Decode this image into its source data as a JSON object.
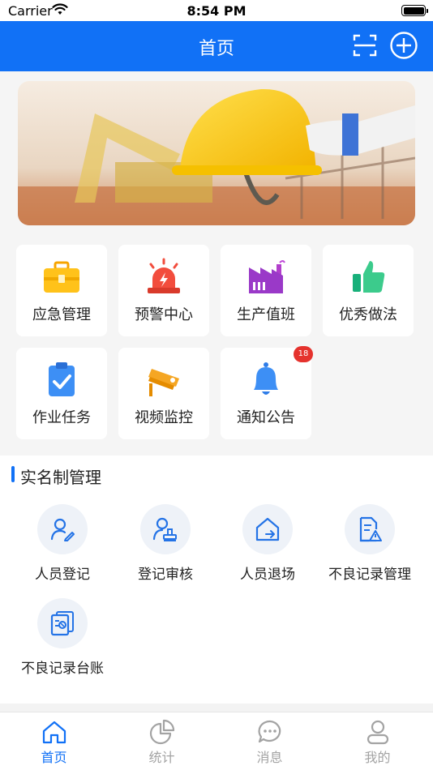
{
  "status_bar": {
    "carrier": "Carrier",
    "time": "8:54 PM"
  },
  "nav": {
    "title": "首页"
  },
  "tiles": [
    {
      "label": "应急管理"
    },
    {
      "label": "预警中心"
    },
    {
      "label": "生产值班"
    },
    {
      "label": "优秀做法"
    },
    {
      "label": "作业任务"
    },
    {
      "label": "视频监控"
    },
    {
      "label": "通知公告",
      "badge": "18"
    }
  ],
  "realname": {
    "title": "实名制管理",
    "items": [
      {
        "label": "人员登记"
      },
      {
        "label": "登记审核"
      },
      {
        "label": "人员退场"
      },
      {
        "label": "不良记录管理"
      },
      {
        "label": "不良记录台账"
      }
    ]
  },
  "tabs": [
    {
      "label": "首页",
      "active": true
    },
    {
      "label": "统计"
    },
    {
      "label": "消息"
    },
    {
      "label": "我的"
    }
  ],
  "colors": {
    "brand": "#1171f6",
    "badge": "#e5322d",
    "tab_inactive": "#a3a3a3"
  }
}
